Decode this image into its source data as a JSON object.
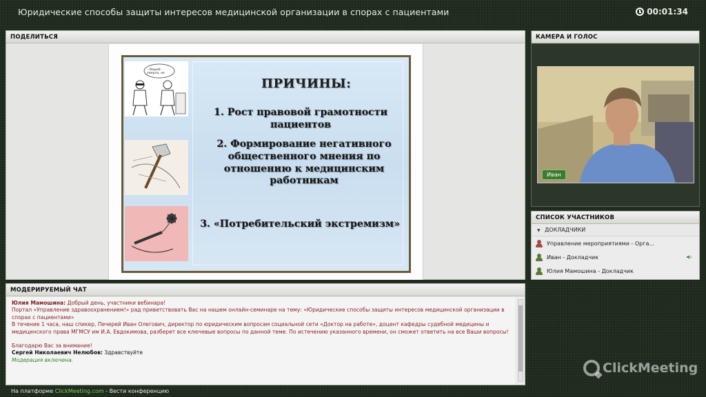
{
  "header": {
    "title": "Юридические способы защиты интересов медицинской организации в спорах с пациентами",
    "timer": "00:01:34"
  },
  "share": {
    "label": "ПОДЕЛИТЬСЯ",
    "slide": {
      "title": "ПРИЧИНЫ:",
      "items": [
        "1.  Рост правовой грамотности пациентов",
        "2. Формирование негативного общественного мнения по отношению к медицинским работникам",
        "3. «Потребительский экстремизм»"
      ],
      "cartoon_caption": "– Вашей смерти, не обязаны!"
    }
  },
  "camera": {
    "label": "КАМЕРА И ГОЛОС",
    "name_tag": "Иван"
  },
  "participants": {
    "label": "СПИСОК УЧАСТНИКОВ",
    "group": "ДОКЛАДЧИКИ",
    "items": [
      {
        "name": "Управление мероприятиями - Орга...",
        "icon": "user-red-icon"
      },
      {
        "name": "Иван - Докладчик",
        "icon": "user-green-icon",
        "speaking": true
      },
      {
        "name": "Юлия Мамошина - Докладчик",
        "icon": "user-green-icon"
      }
    ]
  },
  "chat": {
    "label": "МОДЕРИРУЕМЫЙ ЧАТ",
    "msg1_name": "Юлия Мамошина:",
    "msg1_greeting": " Добрый день, участники вебинара!",
    "msg1_line2": "Портал «Управление здравоохранением!»  рад приветствовать Вас на нашем онлайн-семинаре на тему: «Юридические способы защиты интересов медицинской организации в спорах с пациентами»",
    "msg1_line3": "В течение 1 часа, наш спикер, Печерей Иван Олегович,  директор по юридическим вопросам социальной сети «Доктор на работе», доцент кафедры судебной медицины и медицинского права МГМСУ им И.А. Евдокимова, разберет все ключевые вопросы по данной теме.  По истечению указанного времени, он сможет ответить на все Ваши вопросы!",
    "msg1_line4": "Благодарю Вас за внимание!",
    "msg2_name": "Сергей Николаевич Нелюбов:",
    "msg2_text": " Здравствуйте",
    "moderation": "Модерация включена."
  },
  "brand": {
    "logo_text": "ClickMeeting"
  },
  "footer": {
    "prefix": "На платформе ",
    "link": "ClickMeeting.com",
    "suffix": " - Вести конференцию"
  },
  "colors": {
    "background": "#1e2a1c",
    "accent_green": "#7fcf5a",
    "chat_name": "#7a2020",
    "moderation": "#2e8a1e"
  }
}
